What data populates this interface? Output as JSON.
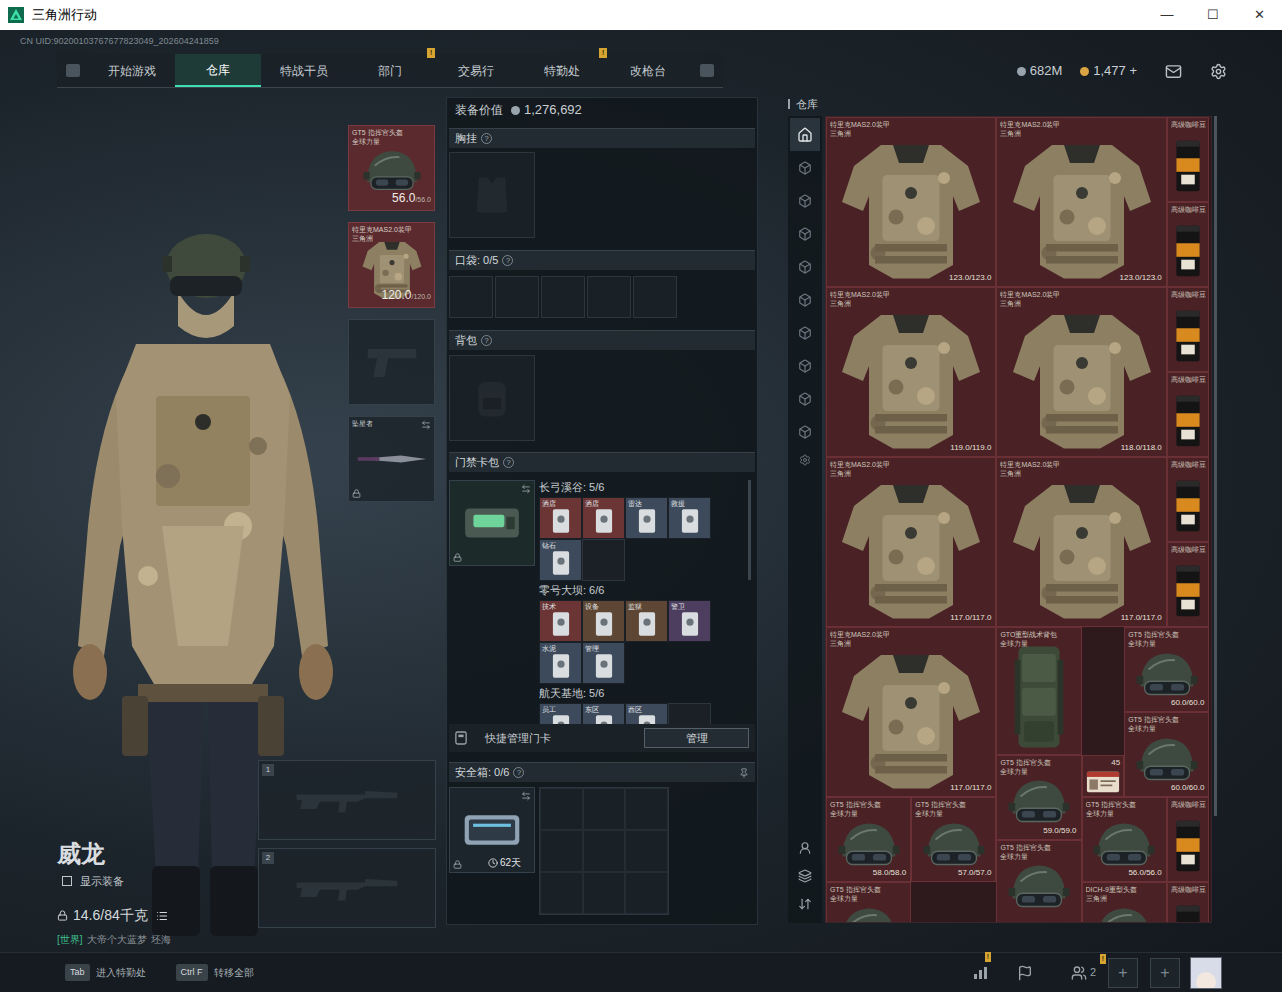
{
  "window": {
    "title": "三角洲行动",
    "controls": [
      "—",
      "☐",
      "✕"
    ]
  },
  "uid": "CN UID:90200103767677823049_202604241859",
  "nav": {
    "tabs": [
      {
        "label": "开始游戏",
        "selected": false,
        "badge": ""
      },
      {
        "label": "仓库",
        "selected": true,
        "badge": ""
      },
      {
        "label": "特战干员",
        "selected": false,
        "badge": ""
      },
      {
        "label": "部门",
        "selected": false,
        "badge": "!"
      },
      {
        "label": "交易行",
        "selected": false,
        "badge": ""
      },
      {
        "label": "特勤处",
        "selected": false,
        "badge": "!"
      },
      {
        "label": "改枪台",
        "selected": false,
        "badge": ""
      }
    ]
  },
  "currencies": [
    {
      "value": "682M",
      "color": "#9aa4ad"
    },
    {
      "value": "1,477 +",
      "color": "#d9a441"
    }
  ],
  "operator": {
    "name": "威龙",
    "show_gear": {
      "label": "显示装备",
      "checked": false
    },
    "weight": "14.6/84千克"
  },
  "chat": {
    "channel": "[世界]",
    "user": "大帝个大蓝梦",
    "message": "坯海"
  },
  "gear_slots": [
    {
      "kind": "helmet",
      "name": "GT5 指挥官头盔",
      "faction": "全球力量",
      "durability": "56.0",
      "max": "/56.0"
    },
    {
      "kind": "armor",
      "name": "特里克MAS2.0装甲",
      "faction": "三角洲",
      "durability": "120.0",
      "max": "/120.0"
    },
    {
      "kind": "pistol"
    },
    {
      "kind": "melee",
      "name": "坠星者",
      "locked": true
    }
  ],
  "weapon_slots": [
    "1",
    "2"
  ],
  "loadout": {
    "value_label": "装备价值",
    "value": "1,276,692",
    "help": "?",
    "chest": "胸挂",
    "pockets": "口袋: 0/5",
    "backpack": "背包",
    "keycard_bag": "门禁卡包",
    "keycard_groups": [
      {
        "map": "长弓溪谷: 5/6",
        "cards": [
          {
            "label": "酒店",
            "color": "#6b3535"
          },
          {
            "label": "酒店",
            "color": "#6b3535"
          },
          {
            "label": "雷达",
            "color": "#3d4a5c"
          },
          {
            "label": "救援",
            "color": "#3d4a5c"
          },
          {
            "label": "钻石",
            "color": "#3d4a5c"
          }
        ]
      },
      {
        "map": "零号大坝: 6/6",
        "cards": [
          {
            "label": "技术",
            "color": "#6b3535"
          },
          {
            "label": "设备",
            "color": "#5e4634"
          },
          {
            "label": "监狱",
            "color": "#5e4634"
          },
          {
            "label": "警卫",
            "color": "#4d3d5e"
          },
          {
            "label": "水泥",
            "color": "#3d4a5c"
          },
          {
            "label": "管理",
            "color": "#3d4a5c"
          }
        ]
      },
      {
        "map": "航天基地: 5/6",
        "cards": [
          {
            "label": "员工",
            "color": "#3d4a5c"
          },
          {
            "label": "东区",
            "color": "#3d4a5c"
          },
          {
            "label": "西区",
            "color": "#3d4a5c"
          }
        ]
      }
    ],
    "quick_manage": "快捷管理门卡",
    "manage_button": "管理",
    "safe_box": "安全箱: 0/6",
    "safe_box_timer": "62天"
  },
  "warehouse": {
    "title": "仓库",
    "tabs": [
      {
        "selected": true
      },
      {
        "selected": false
      },
      {
        "selected": false
      },
      {
        "selected": false
      },
      {
        "selected": false
      },
      {
        "selected": false
      },
      {
        "selected": false
      },
      {
        "selected": false
      },
      {
        "selected": false
      },
      {
        "selected": false
      }
    ],
    "items": [
      {
        "kind": "armor",
        "name": "特里克MAS2.0装甲",
        "faction": "三角洲",
        "durability": "123.0/123.0"
      },
      {
        "kind": "armor",
        "name": "特里克MAS2.0装甲",
        "faction": "三角洲",
        "durability": "123.0/123.0"
      },
      {
        "kind": "coffee",
        "name": "高级咖啡豆"
      },
      {
        "kind": "coffee",
        "name": "高级咖啡豆"
      },
      {
        "kind": "armor",
        "name": "特里克MAS2.0装甲",
        "faction": "三角洲",
        "durability": "119.0/119.0"
      },
      {
        "kind": "armor",
        "name": "特里克MAS2.0装甲",
        "faction": "三角洲",
        "durability": "118.0/118.0"
      },
      {
        "kind": "coffee",
        "name": "高级咖啡豆"
      },
      {
        "kind": "coffee",
        "name": "高级咖啡豆"
      },
      {
        "kind": "armor",
        "name": "特里克MAS2.0装甲",
        "faction": "三角洲",
        "durability": "117.0/117.0"
      },
      {
        "kind": "armor",
        "name": "特里克MAS2.0装甲",
        "faction": "三角洲",
        "durability": "117.0/117.0"
      },
      {
        "kind": "coffee",
        "name": "高级咖啡豆"
      },
      {
        "kind": "coffee",
        "name": "高级咖啡豆"
      },
      {
        "kind": "armor",
        "name": "特里克MAS2.0装甲",
        "faction": "三角洲",
        "durability": "117.0/117.0"
      },
      {
        "kind": "backpack",
        "name": "GTO重型战术背包",
        "faction": "全球力量"
      },
      {
        "kind": "helmet",
        "name": "GT5 指挥官头盔",
        "faction": "全球力量",
        "durability": "60.0/60.0"
      },
      {
        "kind": "helmet",
        "name": "GT5 指挥官头盔",
        "faction": "全球力量",
        "durability": "60.0/60.0"
      },
      {
        "kind": "card",
        "count": "45"
      },
      {
        "kind": "helmet",
        "name": "GT5 指挥官头盔",
        "faction": "全球力量",
        "durability": "59.0/59.0"
      },
      {
        "kind": "helmet",
        "name": "GT5 指挥官头盔",
        "faction": "全球力量",
        "durability": "58.0/58.0"
      },
      {
        "kind": "helmet",
        "name": "GT5 指挥官头盔",
        "faction": "全球力量",
        "durability": "57.0/57.0"
      },
      {
        "kind": "helmet",
        "name": "GT5 指挥官头盔",
        "faction": "全球力量"
      },
      {
        "kind": "helmet",
        "name": "GT5 指挥官头盔",
        "faction": "全球力量",
        "durability": "56.0/56.0"
      },
      {
        "kind": "coffee",
        "name": "高级咖啡豆"
      },
      {
        "kind": "helmet",
        "name": "GT5 指挥官头盔",
        "faction": "全球力量"
      },
      {
        "kind": "helmet",
        "name": "DICH-9重型头盔",
        "faction": "三角洲"
      },
      {
        "kind": "coffee",
        "name": "高级咖啡豆"
      }
    ]
  },
  "bottom_bar": {
    "hints": [
      {
        "key": "Tab",
        "label": "进入特勤处"
      },
      {
        "key": "Ctrl F",
        "label": "转移全部"
      }
    ],
    "stats_badge": "!",
    "friends": "2",
    "friends_badge": "!",
    "add": [
      "+",
      "+"
    ]
  }
}
